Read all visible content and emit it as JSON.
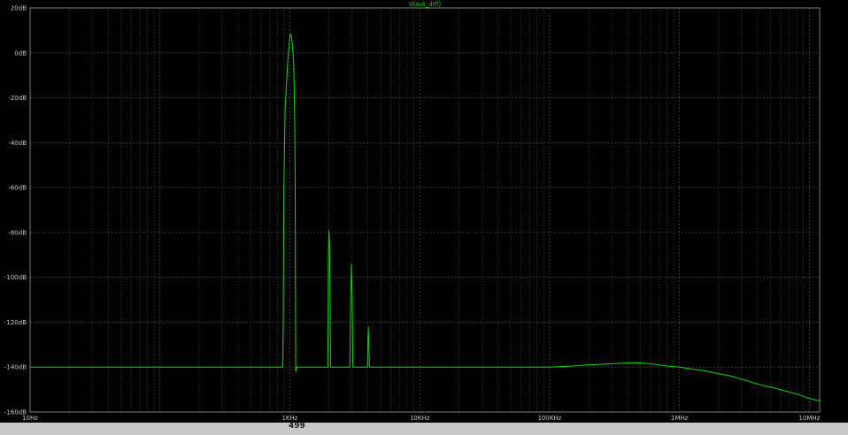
{
  "chart_data": {
    "type": "line",
    "title": "V(out_diff)",
    "xscale": "log",
    "xlim": [
      10,
      12000000
    ],
    "ylim": [
      -160,
      20
    ],
    "x_ticks": [
      {
        "value": 10,
        "label": "10Hz"
      },
      {
        "value": 1000,
        "label": "1KHz"
      },
      {
        "value": 10000,
        "label": "10KHz"
      },
      {
        "value": 100000,
        "label": "100KHz"
      },
      {
        "value": 1000000,
        "label": "1MHz"
      },
      {
        "value": 10000000,
        "label": "10MHz"
      }
    ],
    "y_ticks": [
      {
        "value": 20,
        "label": "20dB"
      },
      {
        "value": 0,
        "label": "0dB"
      },
      {
        "value": -20,
        "label": "-20dB"
      },
      {
        "value": -40,
        "label": "-40dB"
      },
      {
        "value": -60,
        "label": "-60dB"
      },
      {
        "value": -80,
        "label": "-80dB"
      },
      {
        "value": -100,
        "label": "-100dB"
      },
      {
        "value": -120,
        "label": "-120dB"
      },
      {
        "value": -140,
        "label": "-140dB"
      },
      {
        "value": -160,
        "label": "-160dB"
      }
    ],
    "grid": true,
    "colors": {
      "trace": "#00e000",
      "grid": "#5a5a5a",
      "axis": "#9a9a9a",
      "text": "#c8c8c8",
      "background": "#000000"
    },
    "series": [
      {
        "name": "V(out_diff)",
        "points": [
          [
            10,
            -140
          ],
          [
            880,
            -140
          ],
          [
            890,
            -120
          ],
          [
            900,
            -60
          ],
          [
            920,
            -25
          ],
          [
            940,
            -15
          ],
          [
            960,
            -5
          ],
          [
            980,
            2
          ],
          [
            1000,
            7
          ],
          [
            1010,
            8.5
          ],
          [
            1030,
            7
          ],
          [
            1050,
            3
          ],
          [
            1070,
            -5
          ],
          [
            1090,
            -30
          ],
          [
            1100,
            -60
          ],
          [
            1105,
            -108
          ],
          [
            1110,
            -142
          ],
          [
            1130,
            -140
          ],
          [
            1960,
            -140
          ],
          [
            1970,
            -120
          ],
          [
            1980,
            -90
          ],
          [
            2000,
            -79
          ],
          [
            2020,
            -85
          ],
          [
            2040,
            -110
          ],
          [
            2060,
            -140
          ],
          [
            2900,
            -140
          ],
          [
            2930,
            -115
          ],
          [
            2980,
            -94
          ],
          [
            3020,
            -108
          ],
          [
            3060,
            -140
          ],
          [
            3960,
            -140
          ],
          [
            3990,
            -128
          ],
          [
            4020,
            -122
          ],
          [
            4060,
            -130
          ],
          [
            4100,
            -140
          ],
          [
            100000,
            -140
          ],
          [
            150000,
            -139.5
          ],
          [
            200000,
            -139
          ],
          [
            300000,
            -138.5
          ],
          [
            450000,
            -138
          ],
          [
            600000,
            -138.5
          ],
          [
            800000,
            -139.5
          ],
          [
            1000000,
            -140
          ],
          [
            1500000,
            -141.5
          ],
          [
            2500000,
            -144
          ],
          [
            4000000,
            -147.5
          ],
          [
            6000000,
            -150
          ],
          [
            8000000,
            -152
          ],
          [
            10000000,
            -154
          ],
          [
            12000000,
            -155
          ]
        ]
      }
    ]
  },
  "status": {
    "text": "499"
  }
}
